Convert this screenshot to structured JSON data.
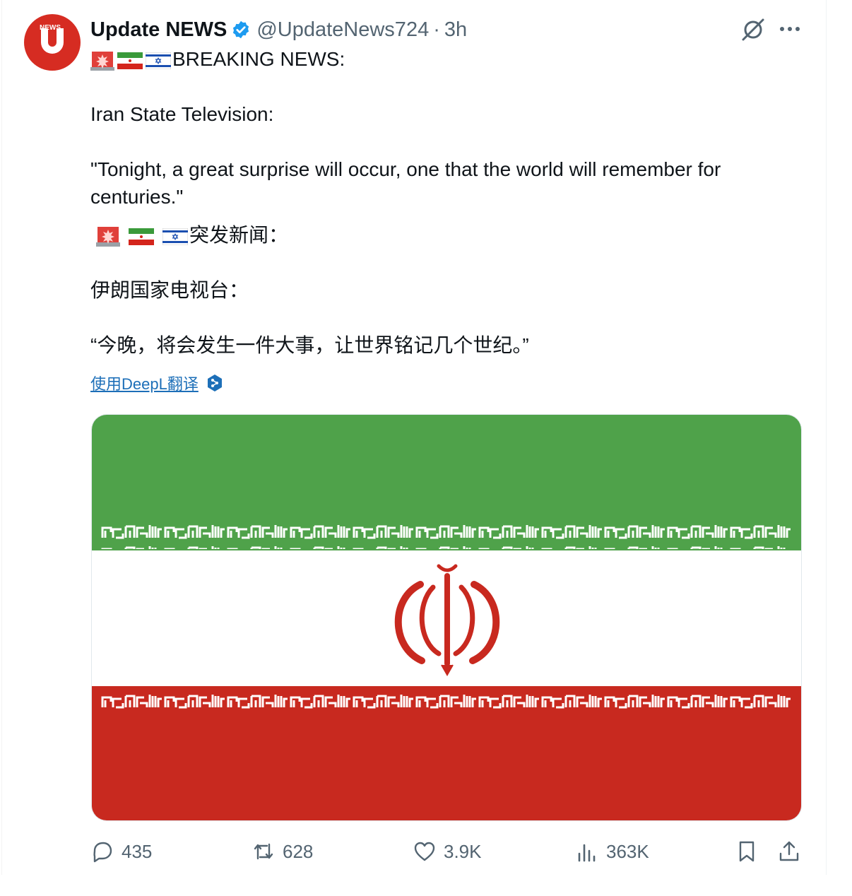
{
  "account": {
    "name": "Update NEWS",
    "handle": "@UpdateNews724",
    "separator": "·",
    "time": "3h",
    "avatar_label": "NEWS",
    "verified_icon": "verified-badge-icon"
  },
  "tweet": {
    "en_heading": "BREAKING NEWS:",
    "en_source": "Iran State Television:",
    "en_quote_line1": "\"Tonight, a great surprise will occur, one that the world will remember for",
    "en_quote_line2": "centuries.\"",
    "zh_heading": "突发新闻：",
    "zh_source": "伊朗国家电视台：",
    "zh_quote": "“今晚，将会发生一件大事，让世界铭记几个世纪。”",
    "flags": [
      "siren-emoji",
      "iran-flag-emoji",
      "israel-flag-emoji"
    ]
  },
  "translate": {
    "label": "使用DeepL翻译",
    "icon": "deepl-icon"
  },
  "media": {
    "subject": "iran-flag-image",
    "colors": {
      "green": "#4fa24a",
      "white": "#ffffff",
      "red": "#c8291f"
    }
  },
  "stats": {
    "replies": "435",
    "reposts": "628",
    "likes": "3.9K",
    "views": "363K"
  },
  "colors": {
    "text": "#0f1419",
    "secondary": "#536471",
    "verified": "#1d9bf0",
    "link": "#1d6fb8",
    "avatar": "#d62c22"
  }
}
